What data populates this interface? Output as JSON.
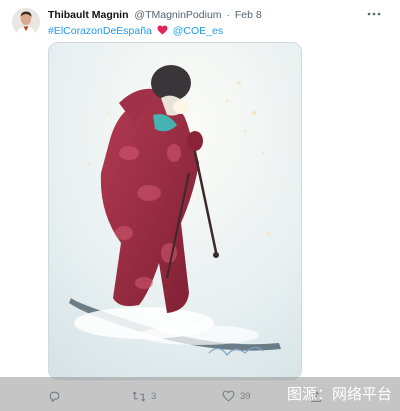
{
  "tweet": {
    "author_name": "Thibault Magnin",
    "handle": "@TMagninPodium",
    "separator": "·",
    "date": "Feb 8",
    "more_label": "•••",
    "hashtag": "#ElCorazonDeEspaña",
    "mention": "@COE_es",
    "heart_color": "#e0245e"
  },
  "actions": {
    "reply_count": "",
    "retweet_count": "3",
    "like_count": "39"
  },
  "watermark": {
    "text": "图源：网络平台"
  },
  "icons": {
    "avatar": "avatar-portrait",
    "more": "more-icon",
    "reply": "reply-icon",
    "retweet": "retweet-icon",
    "like": "like-icon",
    "share": "share-icon",
    "inline_heart": "heart-icon"
  }
}
